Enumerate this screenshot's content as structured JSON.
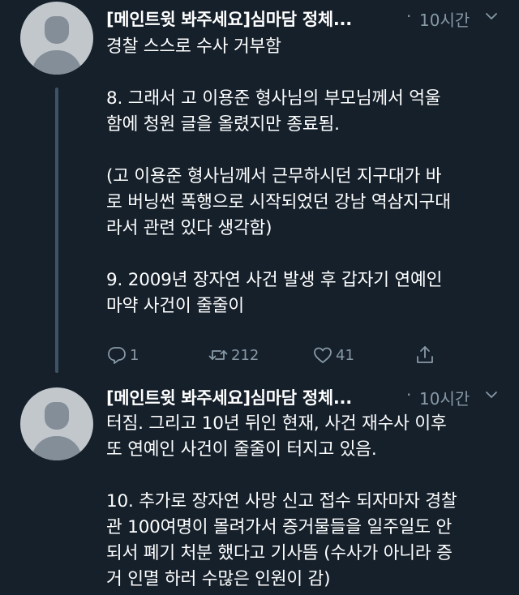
{
  "tweets": [
    {
      "author": "[메인트윗 봐주세요]심마담 정체...",
      "dot": "·",
      "time": "10시간",
      "lines": [
        "경찰 스스로 수사 거부함",
        "",
        "8. 그래서 고 이용준 형사님의 부모님께서 억울",
        "함에 청원 글을 올렸지만 종료됨.",
        "",
        "(고 이용준 형사님께서 근무하시던 지구대가 바",
        "로 버닝썬 폭행으로 시작되었던 강남 역삼지구대",
        "라서 관련 있다 생각함)",
        "",
        "9. 2009년 장자연 사건 발생 후 갑자기 연예인",
        "마약 사건이 줄줄이"
      ],
      "actions": {
        "reply_count": "1",
        "retweet_count": "212",
        "like_count": "41"
      }
    },
    {
      "author": "[메인트윗 봐주세요]심마담 정체...",
      "dot": "·",
      "time": "10시간",
      "lines": [
        "터짐. 그리고 10년 뒤인 현재, 사건 재수사 이후",
        "또 연예인 사건이 줄줄이 터지고 있음.",
        "",
        "10. 추가로 장자연 사망 신고 접수 되자마자 경찰",
        "관 100여명이 몰려가서 증거물들을 일주일도 안",
        "되서 폐기 처분 했다고 기사뜸 (수사가 아니라 증",
        "거 인멸 하러 수많은 인원이 감)"
      ]
    }
  ],
  "colors": {
    "background": "#15202b",
    "text": "#ffffff",
    "secondary": "#8899a6",
    "thread_line": "#3d5466",
    "avatar_bg": "#c2c7cc",
    "avatar_fg": "#848e98"
  }
}
